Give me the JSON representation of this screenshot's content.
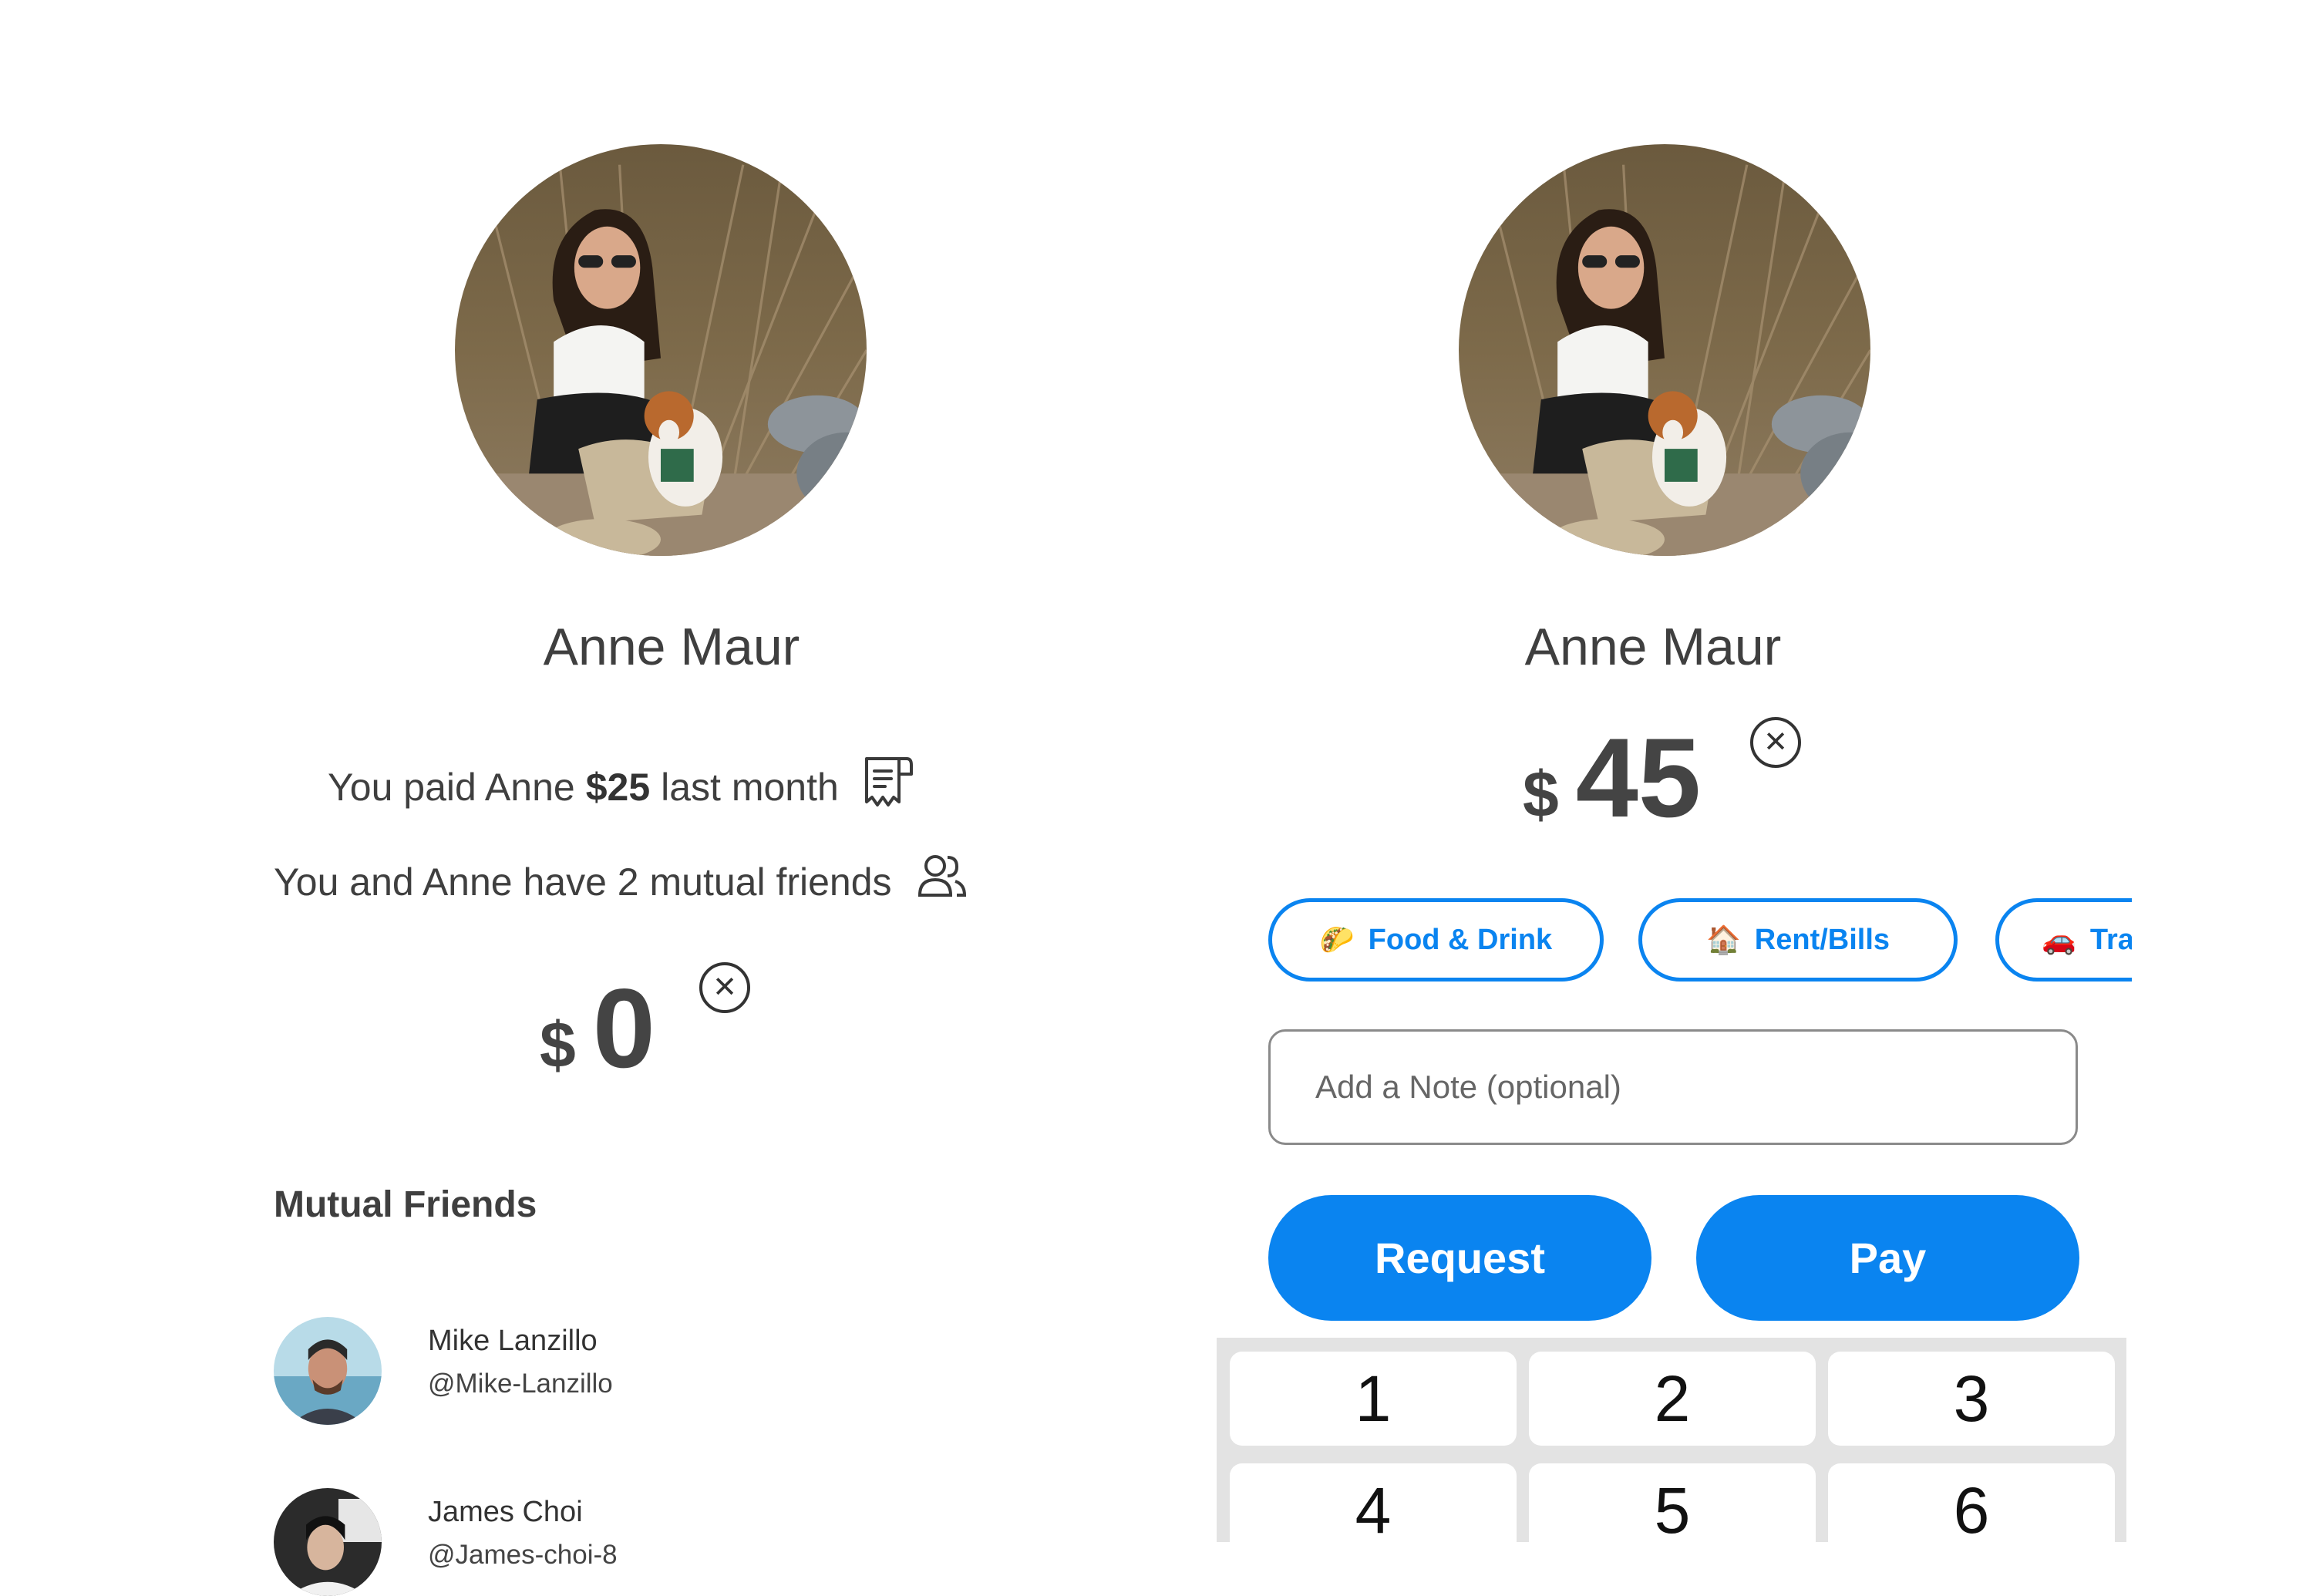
{
  "left_panel": {
    "profile_name": "Anne Maur",
    "paid_prefix": "You paid Anne",
    "paid_amount": "$25",
    "paid_suffix": "last month",
    "mutual_text": "You and Anne have 2 mutual friends",
    "amount_currency": "$",
    "amount_value": "0",
    "clear_symbol": "✕",
    "mutual_friends_title": "Mutual Friends",
    "friends": [
      {
        "name": "Mike Lanzillo",
        "handle": "@Mike-Lanzillo"
      },
      {
        "name": "James Choi",
        "handle": "@James-choi-8"
      }
    ]
  },
  "right_panel": {
    "profile_name": "Anne Maur",
    "amount_currency": "$",
    "amount_value": "45",
    "clear_symbol": "✕",
    "chips": [
      {
        "emoji": "🌮",
        "label": "Food & Drink"
      },
      {
        "emoji": "🏠",
        "label": "Rent/Bills"
      },
      {
        "emoji": "🚗",
        "label": "Travel"
      }
    ],
    "note_placeholder": "Add a Note (optional)",
    "request_label": "Request",
    "pay_label": "Pay",
    "keypad": [
      "1",
      "2",
      "3",
      "4",
      "5",
      "6"
    ]
  },
  "icons": {
    "receipt": "receipt-icon",
    "friends": "users-icon",
    "clear": "close-circle-icon"
  },
  "colors": {
    "accent": "#0a84f0",
    "text": "#3f3f3f",
    "keypad_bg": "#e3e3e3"
  }
}
